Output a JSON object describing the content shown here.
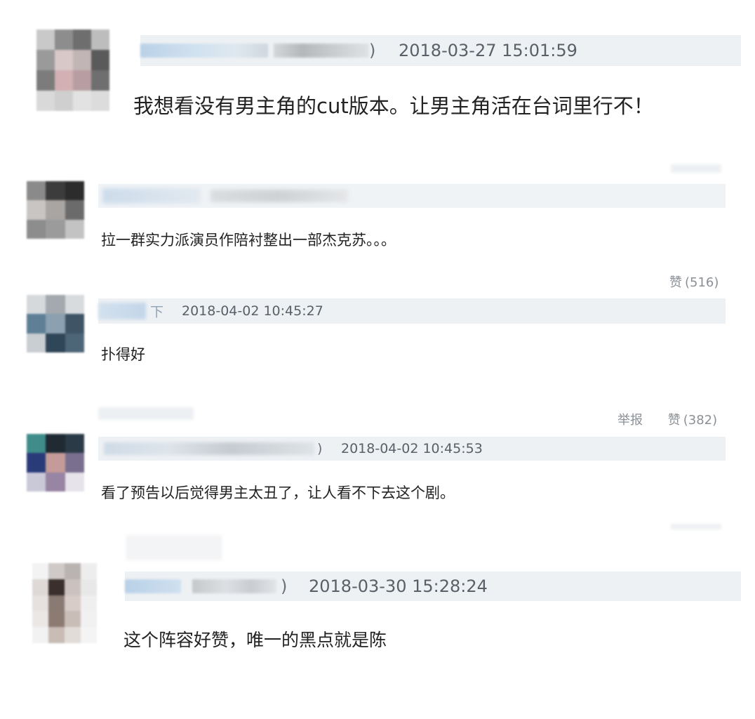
{
  "comments": [
    {
      "id": "c1",
      "name_suffix": ")",
      "timestamp": "2018-03-27 15:01:59",
      "text": "我想看没有男主角的cut版本。让男主角活在台词里行不！"
    },
    {
      "id": "c2",
      "text": "拉一群实力派演员作陪衬整出一部杰克苏。。。",
      "like_label": "赞",
      "like_count": "(516)"
    },
    {
      "id": "c3",
      "name_suffix": "下",
      "timestamp": "2018-04-02 10:45:27",
      "text": "扑得好",
      "report_label": "举报",
      "like_label": "赞",
      "like_count": "(382)"
    },
    {
      "id": "c4",
      "name_suffix": ")",
      "timestamp": "2018-04-02 10:45:53",
      "text": "看了预告以后觉得男主太丑了，让人看不下去这个剧。"
    },
    {
      "id": "c5",
      "name_suffix": ")",
      "timestamp": "2018-03-30 15:28:24",
      "text": "这个阵容好赞，唯一的黑点就是陈"
    }
  ]
}
